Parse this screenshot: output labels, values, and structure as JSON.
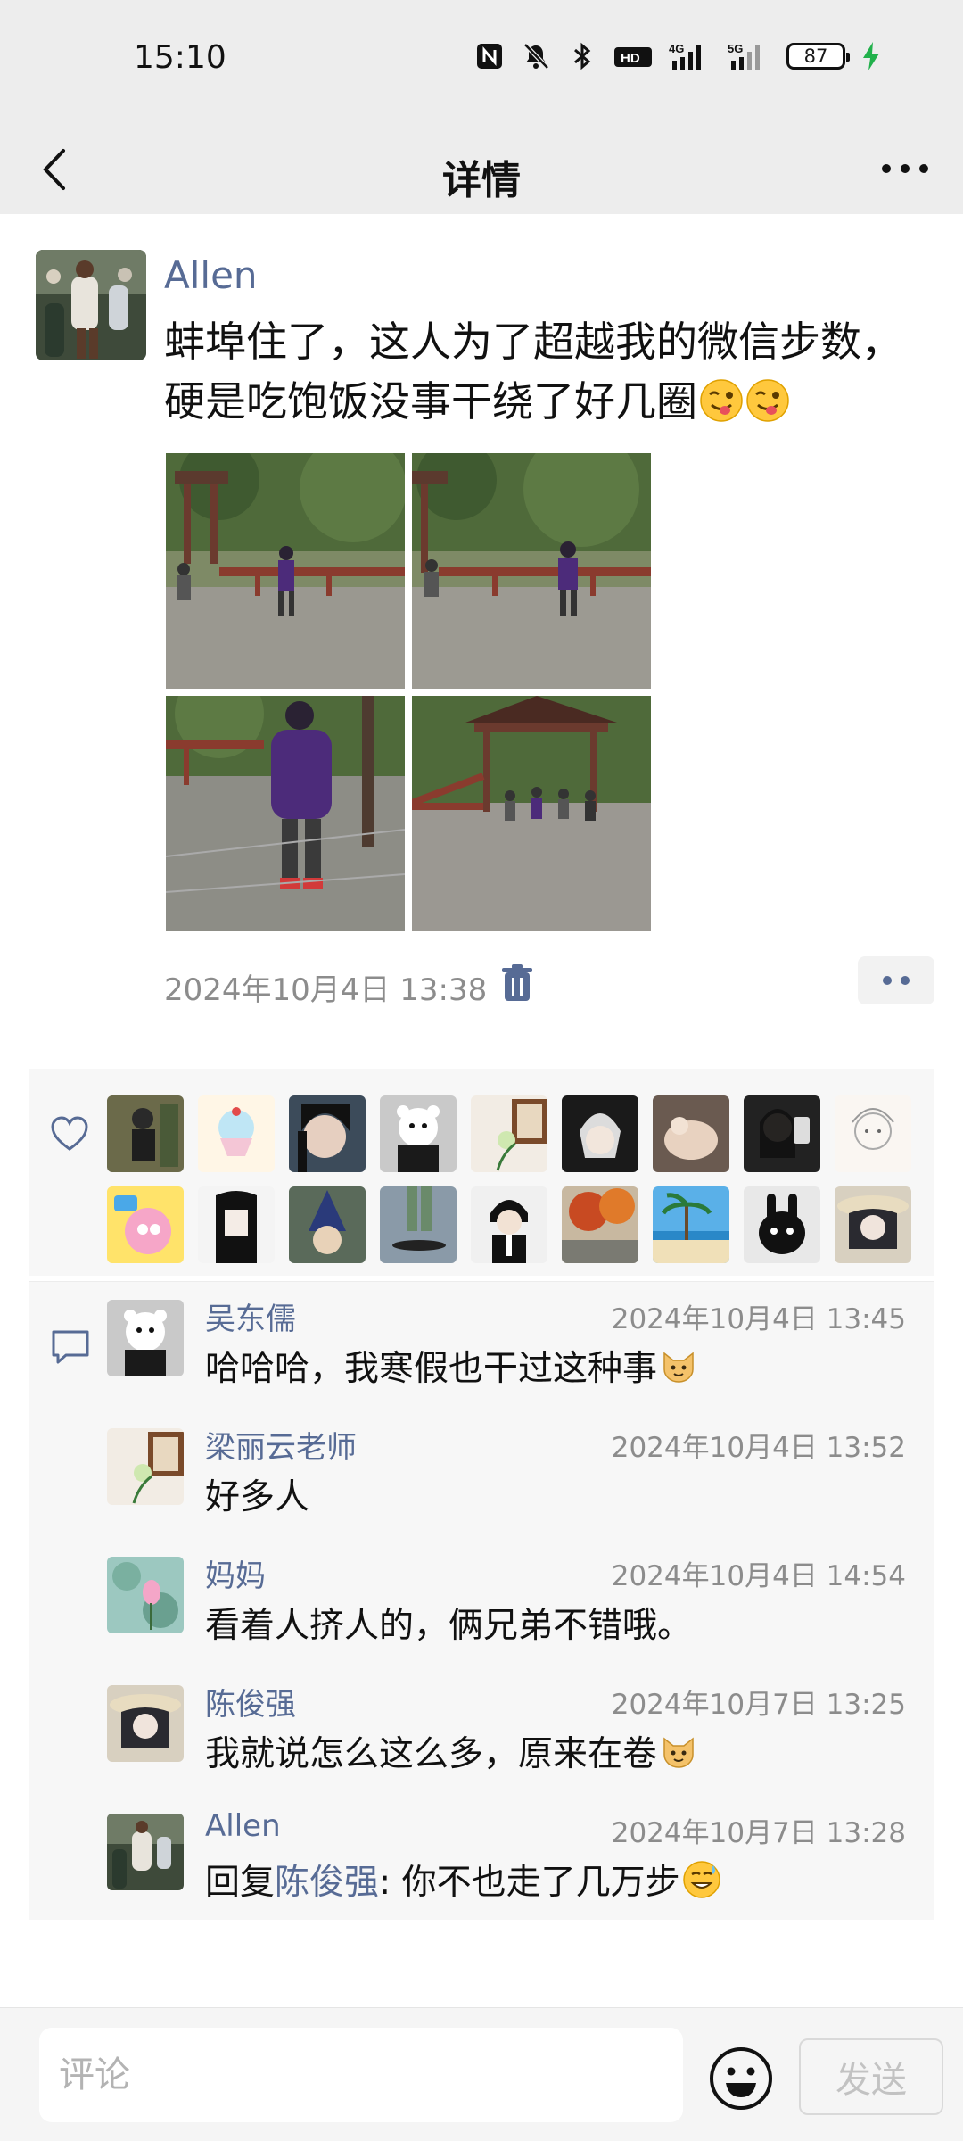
{
  "status_bar": {
    "time": "15:10",
    "icons": [
      "nfc-icon",
      "mute-icon",
      "bluetooth-icon",
      "hd-icon",
      "signal-4g-icon",
      "signal-5g-icon"
    ],
    "battery_level": "87",
    "charging": true
  },
  "header": {
    "title": "详情",
    "back_icon": "back-chevron-icon",
    "more_icon": "more-dots-icon"
  },
  "post": {
    "author": "Allen",
    "text_line1": "蚌埠住了，这人为了超越我的微信步数，",
    "text_line2": "硬是吃饱饭没事干绕了好几圈",
    "text_emojis": [
      "wink-tongue-emoji",
      "wink-tongue-emoji"
    ],
    "photos": [
      "pavilion-photo-1",
      "pavilion-photo-2",
      "pavilion-photo-3",
      "pavilion-photo-4"
    ],
    "time": "2024年10月4日 13:38",
    "delete_icon": "trash-icon",
    "more_action_icon": "two-dots-icon"
  },
  "likes": {
    "icon": "heart-icon",
    "count_shown": 18
  },
  "comments": [
    {
      "name": "吴东儒",
      "time": "2024年10月4日 13:45",
      "text": "哈哈哈，我寒假也干过这种事",
      "emoji": "cat-emoji"
    },
    {
      "name": "梁丽云老师",
      "time": "2024年10月4日 13:52",
      "text": "好多人",
      "emoji": ""
    },
    {
      "name": "妈妈",
      "time": "2024年10月4日 14:54",
      "text": "看着人挤人的，俩兄弟不错哦。",
      "emoji": ""
    },
    {
      "name": "陈俊强",
      "time": "2024年10月7日 13:25",
      "text": "我就说怎么这么多，原来在卷",
      "emoji": "cat-emoji"
    },
    {
      "name": "Allen",
      "time": "2024年10月7日 13:28",
      "reply_prefix": "回复",
      "reply_to": "陈俊强",
      "text": ": 你不也走了几万步",
      "emoji": "sweat-smile-emoji"
    }
  ],
  "bottom_bar": {
    "placeholder": "评论",
    "emoji_icon": "smiley-icon",
    "send_label": "发送"
  },
  "colors": {
    "link_blue": "#576b95",
    "header_bg": "#ededed",
    "panel_bg": "#f7f7f7",
    "time_gray": "#8c8c8c"
  }
}
